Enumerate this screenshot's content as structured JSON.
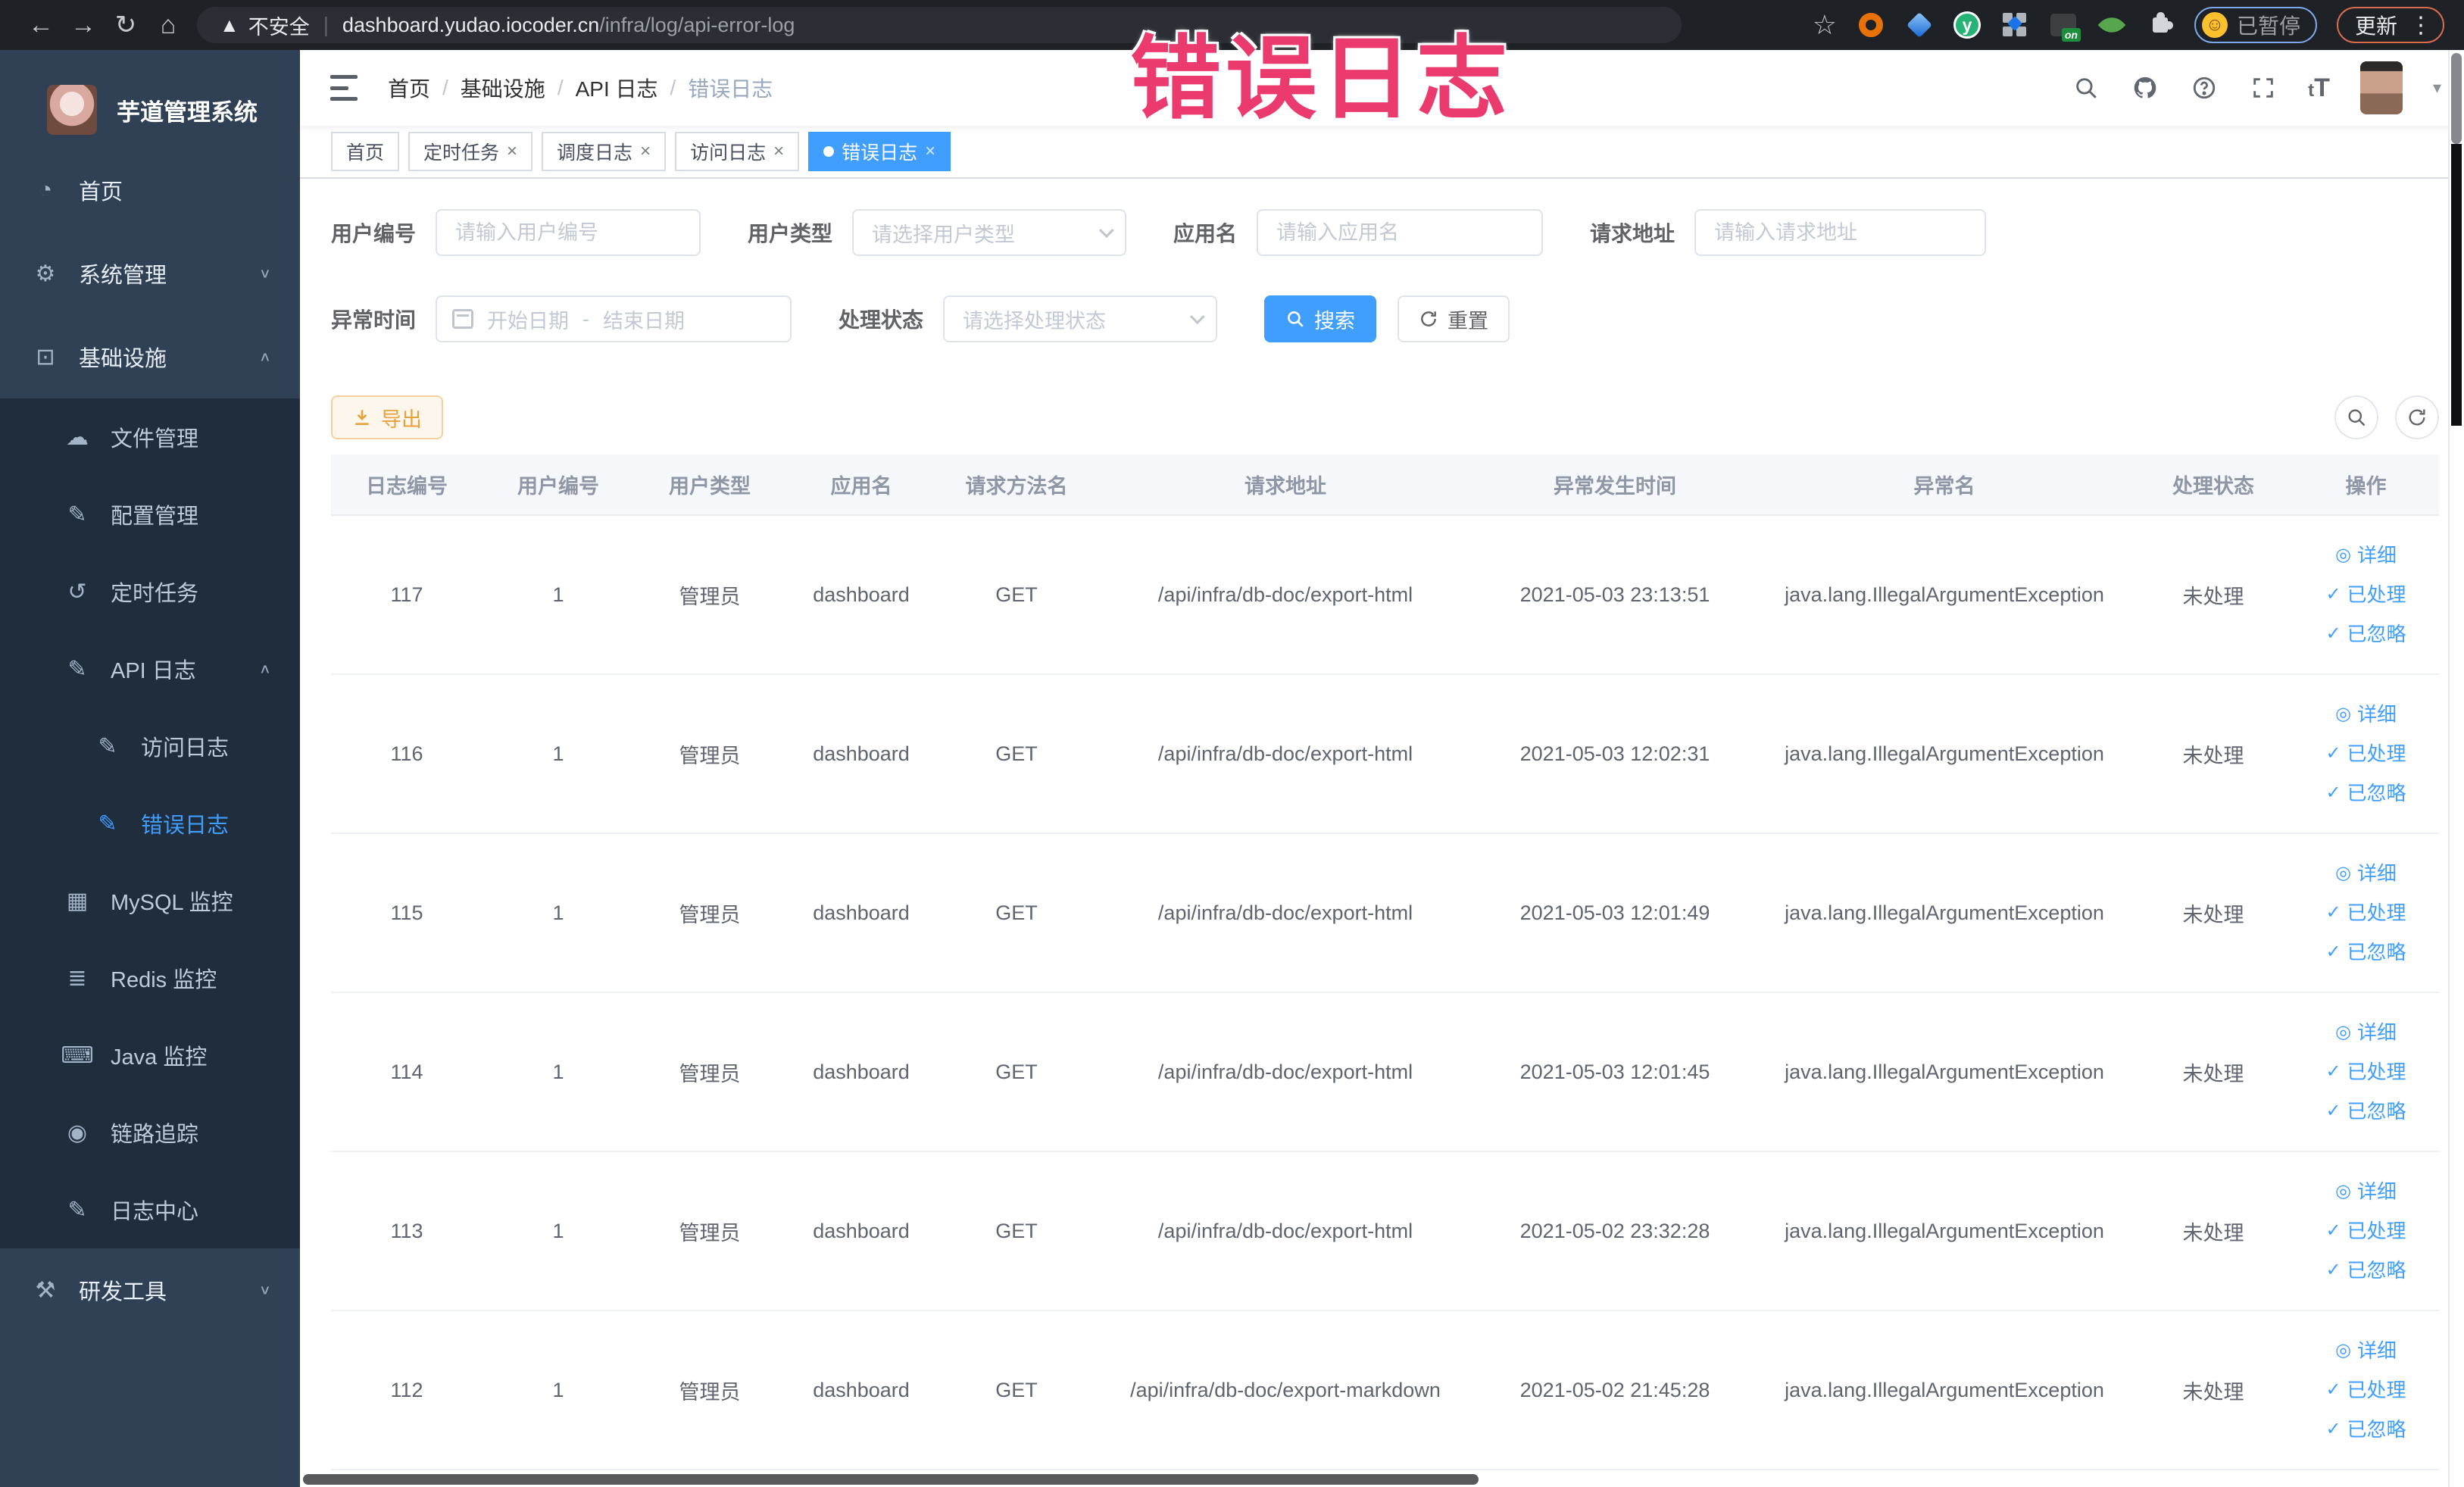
{
  "browser": {
    "nav_icons": [
      "back-icon",
      "forward-icon",
      "reload-icon",
      "home-icon"
    ],
    "security_label": "不安全",
    "url_host": "dashboard.yudao.iocoder.cn",
    "url_path": "/infra/log/api-error-log",
    "ext_icons": [
      "bookmark-star-icon",
      "ext-orange-ring-icon",
      "ext-blue-gem-icon",
      "ext-green-y-icon",
      "ext-grid-icon",
      "ext-on-badge-icon",
      "ext-leaf-icon",
      "extensions-puzzle-icon"
    ],
    "paused_label": "已暂停",
    "update_label": "更新"
  },
  "overlay_title": "错误日志",
  "sidebar": {
    "logo_title": "芋道管理系统",
    "items": [
      {
        "label": "首页",
        "icon": "dashboard-icon",
        "level": 0,
        "in_sub": false,
        "chevron": null,
        "active": false
      },
      {
        "label": "系统管理",
        "icon": "gear-icon",
        "level": 0,
        "in_sub": false,
        "chevron": "down",
        "active": false
      },
      {
        "label": "基础设施",
        "icon": "monitor-icon",
        "level": 0,
        "in_sub": false,
        "chevron": "up",
        "active": false
      },
      {
        "label": "文件管理",
        "icon": "cloud-upload-icon",
        "level": 1,
        "in_sub": true,
        "chevron": null,
        "active": false
      },
      {
        "label": "配置管理",
        "icon": "edit-icon",
        "level": 1,
        "in_sub": true,
        "chevron": null,
        "active": false
      },
      {
        "label": "定时任务",
        "icon": "history-icon",
        "level": 1,
        "in_sub": true,
        "chevron": null,
        "active": false
      },
      {
        "label": "API 日志",
        "icon": "api-log-icon",
        "level": 1,
        "in_sub": true,
        "chevron": "up",
        "active": false
      },
      {
        "label": "访问日志",
        "icon": "access-log-icon",
        "level": 2,
        "in_sub": true,
        "chevron": null,
        "active": false
      },
      {
        "label": "错误日志",
        "icon": "error-log-icon",
        "level": 2,
        "in_sub": true,
        "chevron": null,
        "active": true
      },
      {
        "label": "MySQL 监控",
        "icon": "mysql-chart-icon",
        "level": 1,
        "in_sub": true,
        "chevron": null,
        "active": false
      },
      {
        "label": "Redis 监控",
        "icon": "redis-layers-icon",
        "level": 1,
        "in_sub": true,
        "chevron": null,
        "active": false
      },
      {
        "label": "Java 监控",
        "icon": "java-monitor-icon",
        "level": 1,
        "in_sub": true,
        "chevron": null,
        "active": false
      },
      {
        "label": "链路追踪",
        "icon": "trace-eye-icon",
        "level": 1,
        "in_sub": true,
        "chevron": null,
        "active": false
      },
      {
        "label": "日志中心",
        "icon": "log-center-icon",
        "level": 1,
        "in_sub": true,
        "chevron": null,
        "active": false
      },
      {
        "label": "研发工具",
        "icon": "toolbox-icon",
        "level": 0,
        "in_sub": false,
        "chevron": "down",
        "active": false
      }
    ]
  },
  "header": {
    "breadcrumb": [
      "首页",
      "基础设施",
      "API 日志",
      "错误日志"
    ],
    "icons": [
      "search-icon",
      "github-icon",
      "help-icon",
      "fullscreen-icon",
      "text-size-icon",
      "avatar",
      "caret-down-icon"
    ]
  },
  "tabs": [
    {
      "label": "首页",
      "closable": false,
      "active": false
    },
    {
      "label": "定时任务",
      "closable": true,
      "active": false
    },
    {
      "label": "调度日志",
      "closable": true,
      "active": false
    },
    {
      "label": "访问日志",
      "closable": true,
      "active": false
    },
    {
      "label": "错误日志",
      "closable": true,
      "active": true
    }
  ],
  "filters": {
    "user_id": {
      "label": "用户编号",
      "placeholder": "请输入用户编号"
    },
    "user_type": {
      "label": "用户类型",
      "placeholder": "请选择用户类型"
    },
    "app_name": {
      "label": "应用名",
      "placeholder": "请输入应用名"
    },
    "request_url": {
      "label": "请求地址",
      "placeholder": "请输入请求地址"
    },
    "exception_time": {
      "label": "异常时间",
      "start_placeholder": "开始日期",
      "separator": "-",
      "end_placeholder": "结束日期"
    },
    "process_status": {
      "label": "处理状态",
      "placeholder": "请选择处理状态"
    },
    "search_label": "搜索",
    "reset_label": "重置"
  },
  "toolbar": {
    "export_label": "导出",
    "right_icons": [
      "search-toggle-icon",
      "refresh-icon"
    ]
  },
  "table": {
    "columns": [
      "日志编号",
      "用户编号",
      "用户类型",
      "应用名",
      "请求方法名",
      "请求地址",
      "异常发生时间",
      "异常名",
      "处理状态",
      "操作"
    ],
    "rows": [
      {
        "log_id": "117",
        "user_id": "1",
        "user_type": "管理员",
        "app_name": "dashboard",
        "method": "GET",
        "url": "/api/infra/db-doc/export-html",
        "time": "2021-05-03 23:13:51",
        "exception": "java.lang.IllegalArgumentException",
        "status": "未处理"
      },
      {
        "log_id": "116",
        "user_id": "1",
        "user_type": "管理员",
        "app_name": "dashboard",
        "method": "GET",
        "url": "/api/infra/db-doc/export-html",
        "time": "2021-05-03 12:02:31",
        "exception": "java.lang.IllegalArgumentException",
        "status": "未处理"
      },
      {
        "log_id": "115",
        "user_id": "1",
        "user_type": "管理员",
        "app_name": "dashboard",
        "method": "GET",
        "url": "/api/infra/db-doc/export-html",
        "time": "2021-05-03 12:01:49",
        "exception": "java.lang.IllegalArgumentException",
        "status": "未处理"
      },
      {
        "log_id": "114",
        "user_id": "1",
        "user_type": "管理员",
        "app_name": "dashboard",
        "method": "GET",
        "url": "/api/infra/db-doc/export-html",
        "time": "2021-05-03 12:01:45",
        "exception": "java.lang.IllegalArgumentException",
        "status": "未处理"
      },
      {
        "log_id": "113",
        "user_id": "1",
        "user_type": "管理员",
        "app_name": "dashboard",
        "method": "GET",
        "url": "/api/infra/db-doc/export-html",
        "time": "2021-05-02 23:32:28",
        "exception": "java.lang.IllegalArgumentException",
        "status": "未处理"
      },
      {
        "log_id": "112",
        "user_id": "1",
        "user_type": "管理员",
        "app_name": "dashboard",
        "method": "GET",
        "url": "/api/infra/db-doc/export-markdown",
        "time": "2021-05-02 21:45:28",
        "exception": "java.lang.IllegalArgumentException",
        "status": "未处理"
      }
    ],
    "actions": [
      {
        "icon": "eye-icon",
        "label": "详细"
      },
      {
        "icon": "check-icon",
        "label": "已处理"
      },
      {
        "icon": "check-icon",
        "label": "已忽略"
      }
    ]
  },
  "colors": {
    "accent": "#409eff",
    "warning": "#e6a23c",
    "sidebar_bg": "#304156",
    "submenu_bg": "#1f2d3d",
    "overlay_pink": "#eb3a6e"
  }
}
